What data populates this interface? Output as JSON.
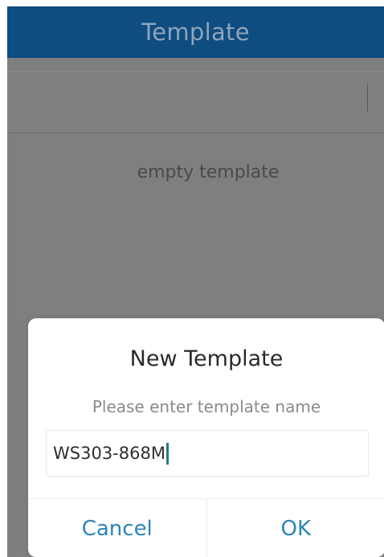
{
  "app_bar": {
    "title": "Template"
  },
  "content": {
    "empty_text": "empty template"
  },
  "dialog": {
    "title": "New Template",
    "message": "Please enter template name",
    "input_value": "WS303-868M",
    "buttons": {
      "cancel": "Cancel",
      "ok": "OK"
    }
  },
  "colors": {
    "app_bar": "#0f4c7f",
    "overlay_background": "#7f7f7f",
    "dialog_background": "#ffffff",
    "button_text": "#2d84b8",
    "caret": "#1f7f7c"
  }
}
